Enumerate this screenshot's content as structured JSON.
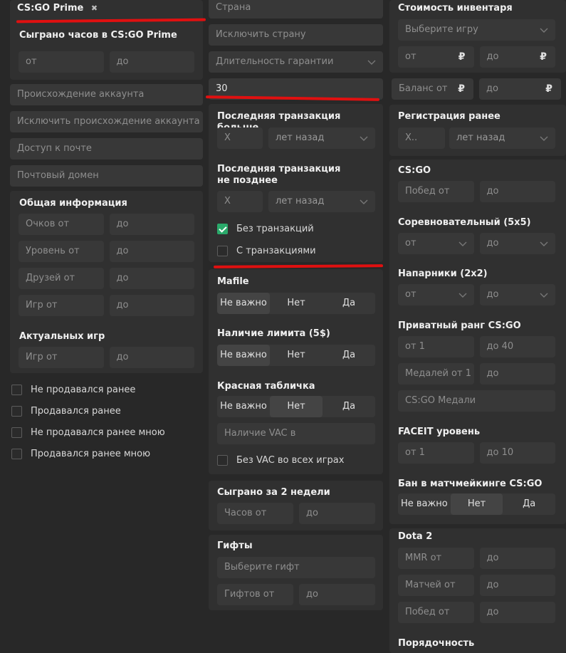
{
  "col1": {
    "tag": {
      "label": "CS:GO Prime",
      "close": "✖"
    },
    "hours": {
      "title": "Сыграно часов в CS:GO Prime",
      "from": "от",
      "to": "до"
    },
    "origin": "Происхождение аккаунта",
    "exclude_origin": "Исключить происхождение аккаунта",
    "mail_access": "Доступ к почте",
    "mail_domain": "Почтовый домен",
    "general": {
      "title": "Общая информация",
      "rows": [
        {
          "from": "Очков от",
          "to": "до"
        },
        {
          "from": "Уровень от",
          "to": "до"
        },
        {
          "from": "Друзей от",
          "to": "до"
        },
        {
          "from": "Игр от",
          "to": "до"
        }
      ],
      "actual_title": "Актуальных игр",
      "actual": {
        "from": "Игр от",
        "to": "до"
      }
    },
    "checks": [
      {
        "label": "Не продавался ранее",
        "checked": false
      },
      {
        "label": "Продавался ранее",
        "checked": false
      },
      {
        "label": "Не продавался ранее мною",
        "checked": false
      },
      {
        "label": "Продавался ранее мною",
        "checked": false
      }
    ]
  },
  "col2": {
    "country": "Страна",
    "exclude_country": "Исключить страну",
    "warranty": "Длительность гарантии",
    "value30": "30",
    "last_tx_more": {
      "title": "Последняя транзакция больше",
      "x": "X",
      "unit": "лет назад"
    },
    "last_tx_not_later": {
      "title": "Последняя транзакция не позднее",
      "x": "X",
      "unit": "лет назад"
    },
    "no_tx": {
      "label": "Без транзакций",
      "checked": true
    },
    "with_tx": {
      "label": "С транзакциями",
      "checked": false
    },
    "mafile": {
      "title": "Mafile",
      "options": [
        "Не важно",
        "Нет",
        "Да"
      ],
      "selected": "Не важно"
    },
    "limit": {
      "title": "Наличие лимита (5$)",
      "options": [
        "Не важно",
        "Нет",
        "Да"
      ],
      "selected": "Не важно"
    },
    "red_plate": {
      "title": "Красная табличка",
      "options": [
        "Не важно",
        "Нет",
        "Да"
      ],
      "selected": "Нет"
    },
    "vac": "Наличие VAC в",
    "no_vac": {
      "label": "Без VAC во всех играх",
      "checked": false
    },
    "two_weeks": {
      "title": "Сыграно за 2 недели",
      "from": "Часов от",
      "to": "до"
    },
    "gifts": {
      "title": "Гифты",
      "select": "Выберите гифт",
      "from": "Гифтов от",
      "to": "до"
    }
  },
  "col3": {
    "inventory": {
      "title": "Стоимость инвентаря",
      "game": "Выберите игру",
      "from": "от",
      "to": "до",
      "currency": "₽"
    },
    "balance": {
      "from": "Баланс от",
      "to": "до",
      "currency": "₽"
    },
    "reg": {
      "title": "Регистрация ранее",
      "x": "X..",
      "unit": "лет назад"
    },
    "csgo": {
      "title": "CS:GO",
      "from": "Побед от",
      "to": "до"
    },
    "comp": {
      "title": "Соревновательный (5x5)",
      "from": "от",
      "to": "до"
    },
    "wingman": {
      "title": "Напарники (2x2)",
      "from": "от",
      "to": "до"
    },
    "private_rank": {
      "title": "Приватный ранг CS:GO",
      "from": "от 1",
      "to": "до 40",
      "medals_from": "Медалей от 1",
      "medals_to": "до",
      "medals": "CS:GO Медали"
    },
    "faceit": {
      "title": "FACEIT уровень",
      "from": "от 1",
      "to": "до 10"
    },
    "ban": {
      "title": "Бан в матчмейкинге CS:GO",
      "options": [
        "Не важно",
        "Нет",
        "Да"
      ],
      "selected": "Нет"
    },
    "dota": {
      "title": "Dota 2",
      "rows": [
        {
          "from": "MMR от",
          "to": "до"
        },
        {
          "from": "Матчей от",
          "to": "до"
        },
        {
          "from": "Побед от",
          "to": "до"
        }
      ]
    },
    "decency": {
      "title": "Порядочность"
    }
  },
  "colors": {
    "accent_green": "#2aa96a",
    "annotation_red": "#e01010",
    "bg": "#282828",
    "card": "#303030",
    "field": "#383838"
  }
}
